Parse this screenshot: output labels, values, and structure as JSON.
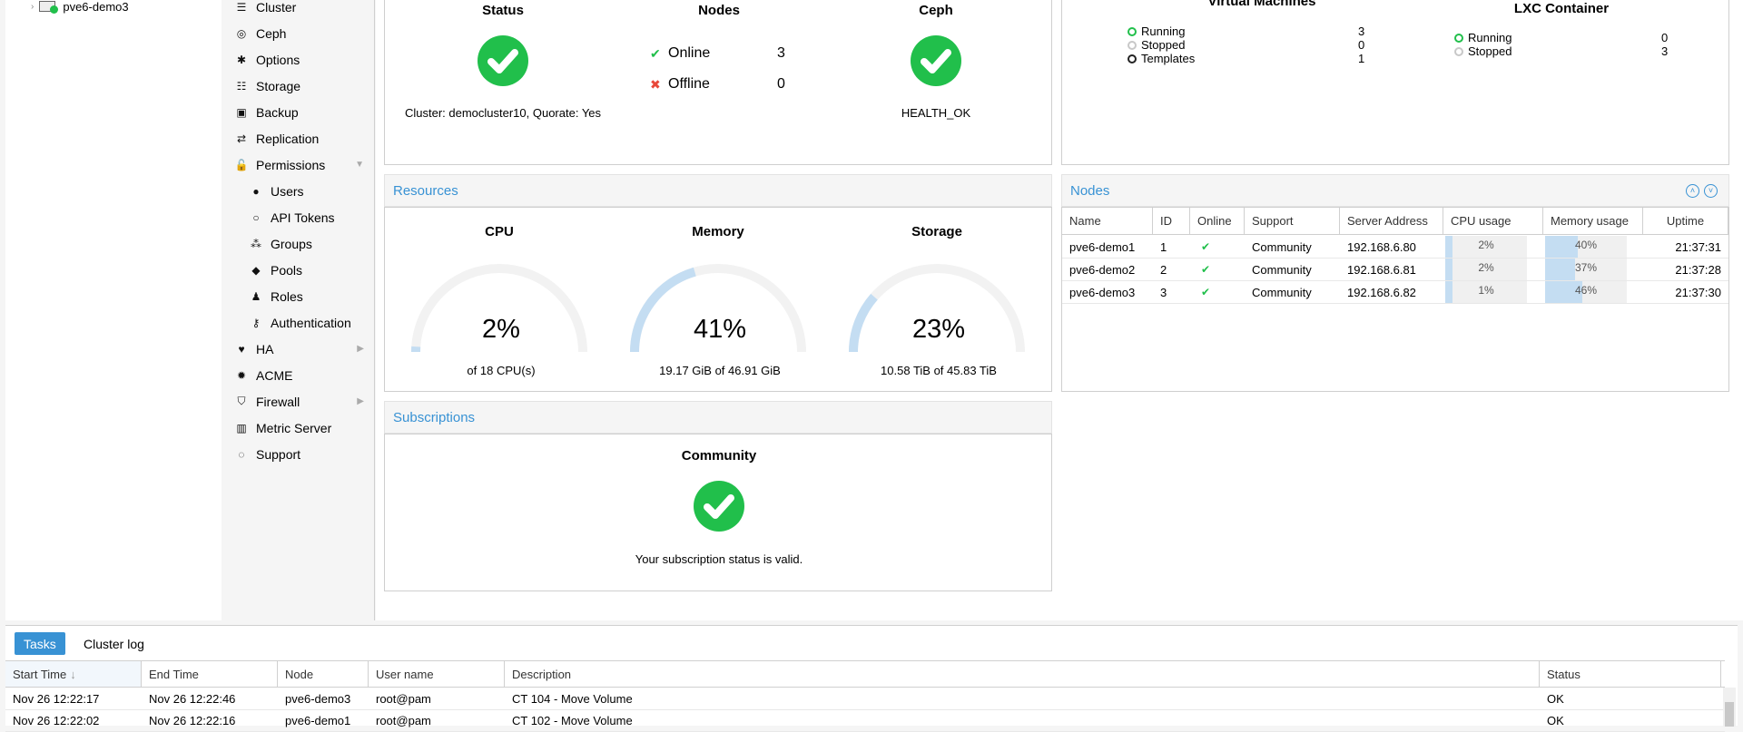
{
  "tree": {
    "node": "pve6-demo3"
  },
  "menu": {
    "items": [
      {
        "label": "Cluster",
        "icon": "server-stack-icon",
        "glyph": "☰",
        "sub": false,
        "arrow": ""
      },
      {
        "label": "Ceph",
        "icon": "ceph-icon",
        "glyph": "◎",
        "sub": false,
        "arrow": ""
      },
      {
        "label": "Options",
        "icon": "gear-icon",
        "glyph": "✱",
        "sub": false,
        "arrow": ""
      },
      {
        "label": "Storage",
        "icon": "database-icon",
        "glyph": "☷",
        "sub": false,
        "arrow": ""
      },
      {
        "label": "Backup",
        "icon": "floppy-icon",
        "glyph": "▣",
        "sub": false,
        "arrow": ""
      },
      {
        "label": "Replication",
        "icon": "retweet-icon",
        "glyph": "⇄",
        "sub": false,
        "arrow": ""
      },
      {
        "label": "Permissions",
        "icon": "unlock-icon",
        "glyph": "🔓",
        "sub": false,
        "arrow": "▼"
      },
      {
        "label": "Users",
        "icon": "user-icon",
        "glyph": "●",
        "sub": true,
        "arrow": ""
      },
      {
        "label": "API Tokens",
        "icon": "user-outline-icon",
        "glyph": "○",
        "sub": true,
        "arrow": ""
      },
      {
        "label": "Groups",
        "icon": "users-icon",
        "glyph": "⁂",
        "sub": true,
        "arrow": ""
      },
      {
        "label": "Pools",
        "icon": "tags-icon",
        "glyph": "◆",
        "sub": true,
        "arrow": ""
      },
      {
        "label": "Roles",
        "icon": "male-icon",
        "glyph": "♟",
        "sub": true,
        "arrow": ""
      },
      {
        "label": "Authentication",
        "icon": "key-icon",
        "glyph": "⚷",
        "sub": true,
        "arrow": ""
      },
      {
        "label": "HA",
        "icon": "heartbeat-icon",
        "glyph": "♥",
        "sub": false,
        "arrow": "▶"
      },
      {
        "label": "ACME",
        "icon": "certificate-icon",
        "glyph": "✹",
        "sub": false,
        "arrow": ""
      },
      {
        "label": "Firewall",
        "icon": "shield-icon",
        "glyph": "⛉",
        "sub": false,
        "arrow": "▶"
      },
      {
        "label": "Metric Server",
        "icon": "bar-chart-icon",
        "glyph": "▥",
        "sub": false,
        "arrow": ""
      },
      {
        "label": "Support",
        "icon": "comments-icon",
        "glyph": "◌",
        "sub": false,
        "arrow": ""
      }
    ]
  },
  "health": {
    "status_title": "Status",
    "cluster_text": "Cluster: democluster10, Quorate: Yes",
    "nodes_title": "Nodes",
    "online_label": "Online",
    "online_value": "3",
    "offline_label": "Offline",
    "offline_value": "0",
    "ceph_title": "Ceph",
    "ceph_status": "HEALTH_OK"
  },
  "guests": {
    "vm_title": "Virtual Machines",
    "vm": [
      {
        "label": "Running",
        "value": "3",
        "color": "#21bf4b"
      },
      {
        "label": "Stopped",
        "value": "0",
        "color": "#c8c8c8"
      },
      {
        "label": "Templates",
        "value": "1",
        "color": "#222222"
      }
    ],
    "lxc_title": "LXC Container",
    "lxc": [
      {
        "label": "Running",
        "value": "0",
        "color": "#21bf4b"
      },
      {
        "label": "Stopped",
        "value": "3",
        "color": "#c8c8c8"
      }
    ]
  },
  "resources": {
    "title": "Resources",
    "gauges": [
      {
        "title": "CPU",
        "pct": "2%",
        "fraction": 0.02,
        "sub": "of 18 CPU(s)"
      },
      {
        "title": "Memory",
        "pct": "41%",
        "fraction": 0.41,
        "sub": "19.17 GiB of 46.91 GiB"
      },
      {
        "title": "Storage",
        "pct": "23%",
        "fraction": 0.23,
        "sub": "10.58 TiB of 45.83 TiB"
      }
    ]
  },
  "nodes_panel": {
    "title": "Nodes",
    "columns": [
      "Name",
      "ID",
      "Online",
      "Support",
      "Server Address",
      "CPU usage",
      "Memory usage",
      "Uptime"
    ],
    "rows": [
      {
        "name": "pve6-demo1",
        "id": "1",
        "support": "Community",
        "addr": "192.168.6.80",
        "cpu": "2%",
        "cpu_f": 0.02,
        "mem": "40%",
        "mem_f": 0.4,
        "uptime": "21:37:31"
      },
      {
        "name": "pve6-demo2",
        "id": "2",
        "support": "Community",
        "addr": "192.168.6.81",
        "cpu": "2%",
        "cpu_f": 0.02,
        "mem": "37%",
        "mem_f": 0.37,
        "uptime": "21:37:28"
      },
      {
        "name": "pve6-demo3",
        "id": "3",
        "support": "Community",
        "addr": "192.168.6.82",
        "cpu": "1%",
        "cpu_f": 0.01,
        "mem": "46%",
        "mem_f": 0.46,
        "uptime": "21:37:30"
      }
    ]
  },
  "subscriptions": {
    "title": "Subscriptions",
    "level": "Community",
    "message": "Your subscription status is valid."
  },
  "bottom": {
    "tabs": [
      "Tasks",
      "Cluster log"
    ],
    "columns": [
      "Start Time",
      "End Time",
      "Node",
      "User name",
      "Description",
      "Status"
    ],
    "rows": [
      {
        "start": "Nov 26 12:22:17",
        "end": "Nov 26 12:22:46",
        "node": "pve6-demo3",
        "user": "root@pam",
        "desc": "CT 104 - Move Volume",
        "status": "OK"
      },
      {
        "start": "Nov 26 12:22:02",
        "end": "Nov 26 12:22:16",
        "node": "pve6-demo1",
        "user": "root@pam",
        "desc": "CT 102 - Move Volume",
        "status": "OK"
      }
    ]
  },
  "colors": {
    "accent": "#3892d4",
    "ok": "#21bf4b",
    "error": "#e8483a"
  }
}
